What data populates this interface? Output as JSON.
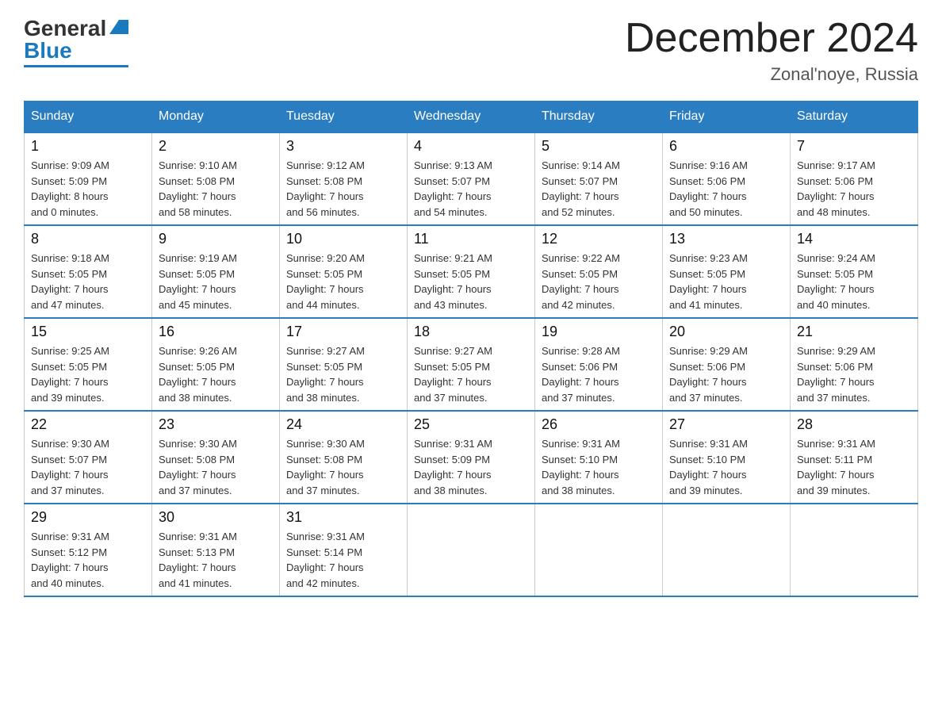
{
  "logo": {
    "general": "General",
    "blue": "Blue"
  },
  "header": {
    "month_year": "December 2024",
    "location": "Zonal'noye, Russia"
  },
  "weekdays": [
    "Sunday",
    "Monday",
    "Tuesday",
    "Wednesday",
    "Thursday",
    "Friday",
    "Saturday"
  ],
  "weeks": [
    [
      {
        "day": "1",
        "sunrise": "9:09 AM",
        "sunset": "5:09 PM",
        "daylight_hours": "8",
        "daylight_minutes": "0"
      },
      {
        "day": "2",
        "sunrise": "9:10 AM",
        "sunset": "5:08 PM",
        "daylight_hours": "7",
        "daylight_minutes": "58"
      },
      {
        "day": "3",
        "sunrise": "9:12 AM",
        "sunset": "5:08 PM",
        "daylight_hours": "7",
        "daylight_minutes": "56"
      },
      {
        "day": "4",
        "sunrise": "9:13 AM",
        "sunset": "5:07 PM",
        "daylight_hours": "7",
        "daylight_minutes": "54"
      },
      {
        "day": "5",
        "sunrise": "9:14 AM",
        "sunset": "5:07 PM",
        "daylight_hours": "7",
        "daylight_minutes": "52"
      },
      {
        "day": "6",
        "sunrise": "9:16 AM",
        "sunset": "5:06 PM",
        "daylight_hours": "7",
        "daylight_minutes": "50"
      },
      {
        "day": "7",
        "sunrise": "9:17 AM",
        "sunset": "5:06 PM",
        "daylight_hours": "7",
        "daylight_minutes": "48"
      }
    ],
    [
      {
        "day": "8",
        "sunrise": "9:18 AM",
        "sunset": "5:05 PM",
        "daylight_hours": "7",
        "daylight_minutes": "47"
      },
      {
        "day": "9",
        "sunrise": "9:19 AM",
        "sunset": "5:05 PM",
        "daylight_hours": "7",
        "daylight_minutes": "45"
      },
      {
        "day": "10",
        "sunrise": "9:20 AM",
        "sunset": "5:05 PM",
        "daylight_hours": "7",
        "daylight_minutes": "44"
      },
      {
        "day": "11",
        "sunrise": "9:21 AM",
        "sunset": "5:05 PM",
        "daylight_hours": "7",
        "daylight_minutes": "43"
      },
      {
        "day": "12",
        "sunrise": "9:22 AM",
        "sunset": "5:05 PM",
        "daylight_hours": "7",
        "daylight_minutes": "42"
      },
      {
        "day": "13",
        "sunrise": "9:23 AM",
        "sunset": "5:05 PM",
        "daylight_hours": "7",
        "daylight_minutes": "41"
      },
      {
        "day": "14",
        "sunrise": "9:24 AM",
        "sunset": "5:05 PM",
        "daylight_hours": "7",
        "daylight_minutes": "40"
      }
    ],
    [
      {
        "day": "15",
        "sunrise": "9:25 AM",
        "sunset": "5:05 PM",
        "daylight_hours": "7",
        "daylight_minutes": "39"
      },
      {
        "day": "16",
        "sunrise": "9:26 AM",
        "sunset": "5:05 PM",
        "daylight_hours": "7",
        "daylight_minutes": "38"
      },
      {
        "day": "17",
        "sunrise": "9:27 AM",
        "sunset": "5:05 PM",
        "daylight_hours": "7",
        "daylight_minutes": "38"
      },
      {
        "day": "18",
        "sunrise": "9:27 AM",
        "sunset": "5:05 PM",
        "daylight_hours": "7",
        "daylight_minutes": "37"
      },
      {
        "day": "19",
        "sunrise": "9:28 AM",
        "sunset": "5:06 PM",
        "daylight_hours": "7",
        "daylight_minutes": "37"
      },
      {
        "day": "20",
        "sunrise": "9:29 AM",
        "sunset": "5:06 PM",
        "daylight_hours": "7",
        "daylight_minutes": "37"
      },
      {
        "day": "21",
        "sunrise": "9:29 AM",
        "sunset": "5:06 PM",
        "daylight_hours": "7",
        "daylight_minutes": "37"
      }
    ],
    [
      {
        "day": "22",
        "sunrise": "9:30 AM",
        "sunset": "5:07 PM",
        "daylight_hours": "7",
        "daylight_minutes": "37"
      },
      {
        "day": "23",
        "sunrise": "9:30 AM",
        "sunset": "5:08 PM",
        "daylight_hours": "7",
        "daylight_minutes": "37"
      },
      {
        "day": "24",
        "sunrise": "9:30 AM",
        "sunset": "5:08 PM",
        "daylight_hours": "7",
        "daylight_minutes": "37"
      },
      {
        "day": "25",
        "sunrise": "9:31 AM",
        "sunset": "5:09 PM",
        "daylight_hours": "7",
        "daylight_minutes": "38"
      },
      {
        "day": "26",
        "sunrise": "9:31 AM",
        "sunset": "5:10 PM",
        "daylight_hours": "7",
        "daylight_minutes": "38"
      },
      {
        "day": "27",
        "sunrise": "9:31 AM",
        "sunset": "5:10 PM",
        "daylight_hours": "7",
        "daylight_minutes": "39"
      },
      {
        "day": "28",
        "sunrise": "9:31 AM",
        "sunset": "5:11 PM",
        "daylight_hours": "7",
        "daylight_minutes": "39"
      }
    ],
    [
      {
        "day": "29",
        "sunrise": "9:31 AM",
        "sunset": "5:12 PM",
        "daylight_hours": "7",
        "daylight_minutes": "40"
      },
      {
        "day": "30",
        "sunrise": "9:31 AM",
        "sunset": "5:13 PM",
        "daylight_hours": "7",
        "daylight_minutes": "41"
      },
      {
        "day": "31",
        "sunrise": "9:31 AM",
        "sunset": "5:14 PM",
        "daylight_hours": "7",
        "daylight_minutes": "42"
      },
      null,
      null,
      null,
      null
    ]
  ]
}
